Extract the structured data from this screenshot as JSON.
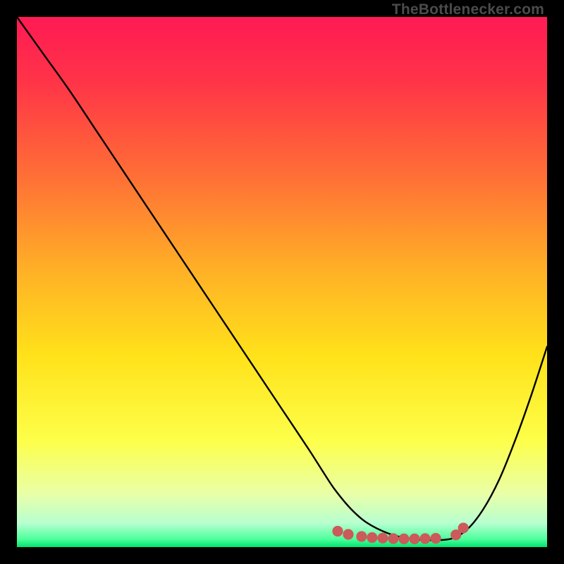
{
  "watermark": "TheBottlenecker.com",
  "chart_data": {
    "type": "line",
    "title": "",
    "xlabel": "",
    "ylabel": "",
    "xlim": [
      0,
      100
    ],
    "ylim": [
      0,
      100
    ],
    "grid": false,
    "legend": false,
    "gradient_stops": [
      {
        "offset": 0.0,
        "color": "#ff1a54"
      },
      {
        "offset": 0.12,
        "color": "#ff3348"
      },
      {
        "offset": 0.3,
        "color": "#ff6f36"
      },
      {
        "offset": 0.48,
        "color": "#ffb126"
      },
      {
        "offset": 0.64,
        "color": "#ffe21a"
      },
      {
        "offset": 0.8,
        "color": "#fdff4a"
      },
      {
        "offset": 0.9,
        "color": "#e9ffa8"
      },
      {
        "offset": 0.955,
        "color": "#b7ffd0"
      },
      {
        "offset": 0.985,
        "color": "#4dff9c"
      },
      {
        "offset": 1.0,
        "color": "#00e36f"
      }
    ],
    "series": [
      {
        "name": "bottleneck-curve",
        "color": "#000000",
        "x": [
          0.0,
          5,
          10,
          15,
          20,
          25,
          30,
          35,
          40,
          45,
          50,
          55,
          58,
          60,
          63,
          66,
          70,
          74,
          78,
          82,
          85,
          88,
          91,
          94,
          97,
          100
        ],
        "y": [
          100,
          93,
          86,
          78.5,
          71,
          63.5,
          56,
          48.5,
          41,
          33.5,
          26,
          18.5,
          13.8,
          10.8,
          7.2,
          4.6,
          2.6,
          1.6,
          1.3,
          1.6,
          3.4,
          7.2,
          12.8,
          20.2,
          28.6,
          37.8
        ]
      }
    ],
    "marker_cluster": {
      "name": "highlight-dots",
      "color": "#cc5a5a",
      "radius": 7.6,
      "points": [
        {
          "x": 60.5,
          "y": 3.0
        },
        {
          "x": 62.5,
          "y": 2.4
        },
        {
          "x": 65.0,
          "y": 2.0
        },
        {
          "x": 67.0,
          "y": 1.8
        },
        {
          "x": 69.0,
          "y": 1.7
        },
        {
          "x": 71.0,
          "y": 1.6
        },
        {
          "x": 73.0,
          "y": 1.55
        },
        {
          "x": 75.0,
          "y": 1.55
        },
        {
          "x": 77.0,
          "y": 1.6
        },
        {
          "x": 79.0,
          "y": 1.65
        },
        {
          "x": 82.8,
          "y": 2.3
        },
        {
          "x": 84.2,
          "y": 3.6
        }
      ]
    }
  }
}
